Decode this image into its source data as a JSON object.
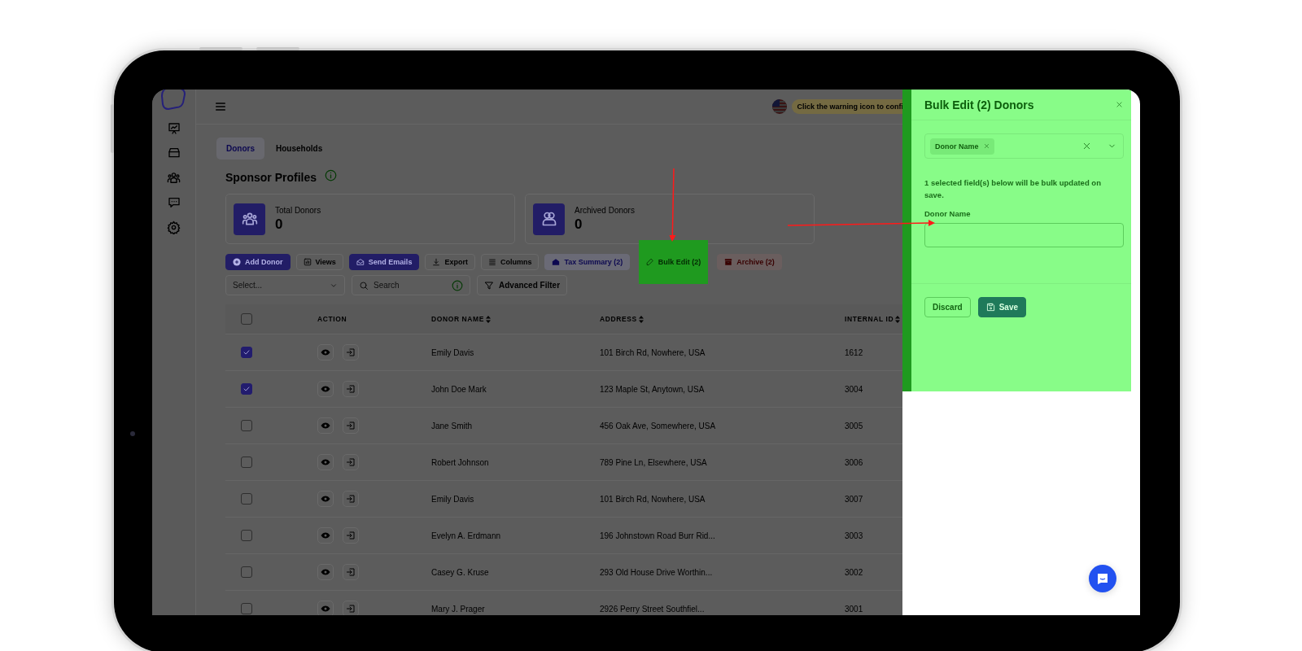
{
  "header": {
    "warning_text": "Click the warning icon to confi"
  },
  "tabs": [
    {
      "label": "Donors",
      "selected": true
    },
    {
      "label": "Households",
      "selected": false
    }
  ],
  "page_title": "Sponsor Profiles",
  "stats": [
    {
      "label": "Total Donors",
      "value": "0"
    },
    {
      "label": "Archived Donors",
      "value": "0"
    }
  ],
  "toolbar": [
    {
      "label": "Add Donor",
      "kind": "primary"
    },
    {
      "label": "Views",
      "kind": "outline"
    },
    {
      "label": "Send Emails",
      "kind": "primary"
    },
    {
      "label": "Export",
      "kind": "outline"
    },
    {
      "label": "Columns",
      "kind": "outline"
    },
    {
      "label": "Tax Summary (2)",
      "kind": "tinted"
    },
    {
      "label": "Bulk Edit (2)",
      "kind": "highlighted"
    },
    {
      "label": "Archive (2)",
      "kind": "danger"
    }
  ],
  "filters": {
    "select_placeholder": "Select...",
    "search_placeholder": "Search",
    "advanced_filter": "Advanced Filter"
  },
  "table": {
    "all_selected": false,
    "columns": [
      {
        "label": "ACTION",
        "sortable": false
      },
      {
        "label": "DONOR NAME",
        "sortable": true
      },
      {
        "label": "ADDRESS",
        "sortable": true
      },
      {
        "label": "INTERNAL ID",
        "sortable": true
      }
    ],
    "rows": [
      {
        "selected": true,
        "donor_name": "Emily Davis",
        "address": "101 Birch Rd, Nowhere, USA",
        "internal_id": "1612"
      },
      {
        "selected": true,
        "donor_name": "John Doe Mark",
        "address": "123 Maple St, Anytown, USA",
        "internal_id": "3004"
      },
      {
        "selected": false,
        "donor_name": "Jane Smith",
        "address": "456 Oak Ave, Somewhere, USA",
        "internal_id": "3005"
      },
      {
        "selected": false,
        "donor_name": "Robert Johnson",
        "address": "789 Pine Ln, Elsewhere, USA",
        "internal_id": "3006"
      },
      {
        "selected": false,
        "donor_name": "Emily Davis",
        "address": "101 Birch Rd, Nowhere, USA",
        "internal_id": "3007"
      },
      {
        "selected": false,
        "donor_name": "Evelyn A. Erdmann",
        "address": "196 Johnstown Road Burr Rid...",
        "internal_id": "3003"
      },
      {
        "selected": false,
        "donor_name": "Casey G. Kruse",
        "address": "293 Old House Drive Worthin...",
        "internal_id": "3002"
      },
      {
        "selected": false,
        "donor_name": "Mary J. Prager",
        "address": "2926 Perry Street Southfiel...",
        "internal_id": "3001"
      }
    ]
  },
  "drawer": {
    "title": "Bulk Edit (2) Donors",
    "field_picker": {
      "tags": [
        "Donor Name"
      ]
    },
    "info": "1 selected field(s) below will be bulk updated on save.",
    "fields": [
      {
        "label": "Donor Name"
      }
    ],
    "buttons": [
      {
        "label": "Discard",
        "kind": "secondary"
      },
      {
        "label": "Save",
        "kind": "primary"
      }
    ]
  }
}
